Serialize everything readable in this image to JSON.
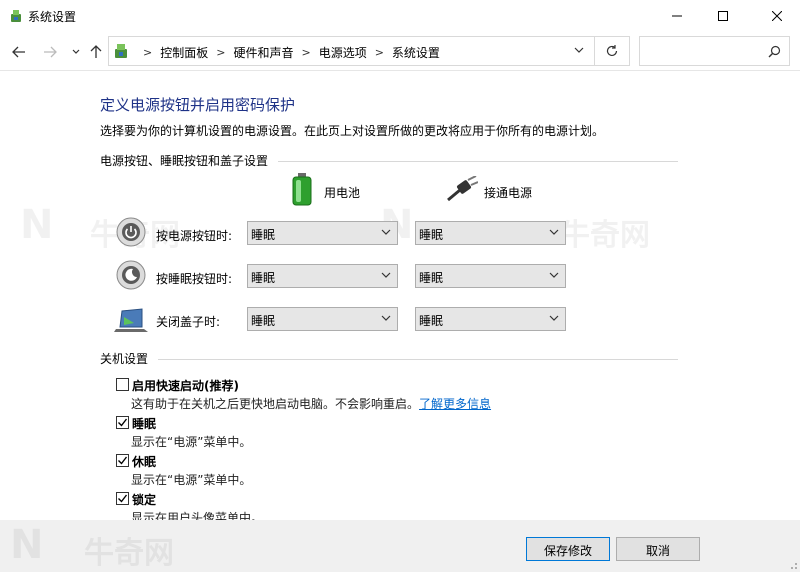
{
  "window": {
    "title": "系统设置"
  },
  "nav": {
    "breadcrumbs": [
      "控制面板",
      "硬件和声音",
      "电源选项",
      "系统设置"
    ],
    "search_placeholder": ""
  },
  "page": {
    "heading": "定义电源按钮并启用密码保护",
    "description": "选择要为你的计算机设置的电源设置。在此页上对设置所做的更改将应用于你所有的电源计划。"
  },
  "power_section": {
    "title": "电源按钮、睡眠按钮和盖子设置",
    "col_battery": "用电池",
    "col_plugged": "接通电源",
    "rows": [
      {
        "label": "按电源按钮时:",
        "battery": "睡眠",
        "plugged": "睡眠",
        "icon": "power-button-icon"
      },
      {
        "label": "按睡眠按钮时:",
        "battery": "睡眠",
        "plugged": "睡眠",
        "icon": "sleep-button-icon"
      },
      {
        "label": "关闭盖子时:",
        "battery": "睡眠",
        "plugged": "睡眠",
        "icon": "laptop-lid-icon"
      }
    ]
  },
  "shutdown_section": {
    "title": "关机设置",
    "items": [
      {
        "label": "启用快速启动(推荐)",
        "desc": "这有助于在关机之后更快地启动电脑。不会影响重启。",
        "link": "了解更多信息",
        "checked": false
      },
      {
        "label": "睡眠",
        "desc": "显示在“电源”菜单中。",
        "checked": true
      },
      {
        "label": "休眠",
        "desc": "显示在“电源”菜单中。",
        "checked": true
      },
      {
        "label": "锁定",
        "desc": "显示在用户头像菜单中。",
        "checked": true
      }
    ]
  },
  "footer": {
    "save_label": "保存修改",
    "cancel_label": "取消"
  },
  "colors": {
    "heading": "#1e3287",
    "link": "#0066cc",
    "accent": "#0078d7"
  }
}
